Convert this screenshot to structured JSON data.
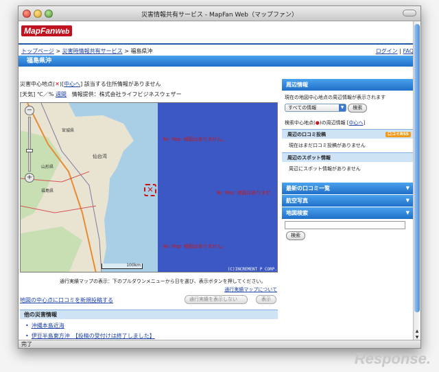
{
  "window": {
    "title": "災害情報共有サービス - MapFan Web（マップファン）"
  },
  "logo": {
    "brand": "MapFan",
    "brand_suffix": "Web"
  },
  "breadcrumb": {
    "home": "トップページ",
    "service": "災害時情報共有サービス",
    "current": "福島県沖",
    "sep": ">"
  },
  "toplinks": {
    "login": "ログイン",
    "faq": "FAQ",
    "sep": "|"
  },
  "region": {
    "name": "福島県沖"
  },
  "center_info": {
    "prefix": "災害中心地点(",
    "marker": "✕",
    "mid": ")[",
    "to_center": "中心へ",
    "suffix": "] 該当する住所情報がありません"
  },
  "weather": {
    "label": "[天気]",
    "temp": "℃／%",
    "weekly": "週間",
    "provider": "情報提供：株式会社ライフビジネスウェザー"
  },
  "map": {
    "no_map_text": "No Map 地図はありません。",
    "no_map_text_cut": "No Map 地図はありませ",
    "places": {
      "miyagi": "宮城県",
      "sendai": "仙台湾",
      "yamagata": "山形県",
      "fukushima": "福島県"
    },
    "scale": "100km",
    "copyright": "(C)INCREMENT P CORP.",
    "zoom_in": "+",
    "zoom_out": "−"
  },
  "tracks": {
    "note": "通行実績マップの表示：下のプルダウンメニューから日を選び、表示ボタンを押してください。",
    "about_link": "通行実績マップについて",
    "select_value": "通行実績を表示しない",
    "show_button": "表示"
  },
  "post_link": "地図の中心点に口コミを新規投稿する",
  "other_disasters": {
    "heading": "他の災害情報",
    "items": [
      "沖縄本島近海",
      "伊豆半島東方沖　【投稿の受付けは終了しました】"
    ]
  },
  "right": {
    "nearby": {
      "heading": "周辺情報",
      "desc": "現在の地図中心地点の周辺情報が表示されます",
      "select_value": "すべての情報",
      "search_button": "検索",
      "search_center_prefix": "検索中心地点(",
      "search_center_suffix": ")の周辺情報 [",
      "to_center": "中心へ",
      "close": "]",
      "reviews_head": "周辺の口コミ投稿",
      "rss_badge": "口コミRSS",
      "reviews_empty": "現在はまだ口コミ投稿がありません",
      "spots_head": "周辺のスポット情報",
      "spots_empty": "周辺にスポット情報がありません"
    },
    "latest_reviews": "最新の口コミ一覧",
    "aerial": "航空写真",
    "map_search": {
      "heading": "地図検索",
      "button": "検索"
    }
  },
  "status": "完了",
  "watermark": "Response."
}
